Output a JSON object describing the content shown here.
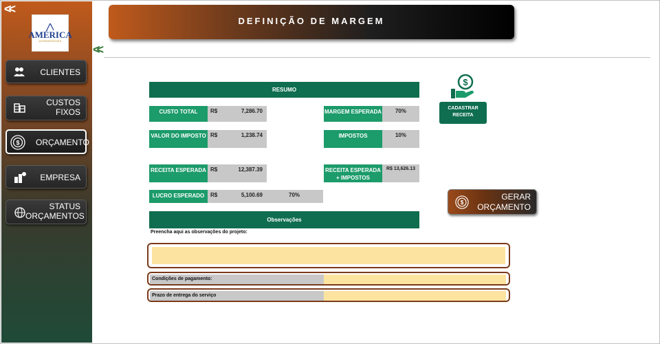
{
  "sidebar": {
    "collapse_icon": "double-chevron-left-icon",
    "logo": {
      "main": "AMÉRICA",
      "sub": "AGRIMENSURA"
    },
    "items": [
      {
        "label": "CLIENTES",
        "icon": "users-icon"
      },
      {
        "label": "CUSTOS FIXOS",
        "icon": "coins-icon"
      },
      {
        "label": "ORÇAMENTO",
        "icon": "target-dollar-icon",
        "active": true
      },
      {
        "label": "EMPRESA",
        "icon": "building-icon"
      },
      {
        "label": "STATUS ORÇAMENTOS",
        "icon": "globe-icon"
      }
    ]
  },
  "header": {
    "title": "DEFINIÇÃO DE MARGEM"
  },
  "resumo": {
    "title": "RESUMO",
    "custo_total": {
      "label": "CUSTO TOTAL",
      "currency": "R$",
      "value": "7,286.70"
    },
    "valor_imposto": {
      "label": "VALOR DO IMPOSTO",
      "currency": "R$",
      "value": "1,238.74"
    },
    "receita_esperada": {
      "label": "RECEITA ESPERADA",
      "currency": "R$",
      "value": "12,387.39"
    },
    "lucro_esperado": {
      "label": "LUCRO ESPERADO",
      "currency": "R$",
      "value": "5,100.69",
      "percent": "70%"
    },
    "margem_esperada": {
      "label": "MARGEM ESPERADA",
      "value": "70%"
    },
    "impostos": {
      "label": "IMPOSTOS",
      "value": "10%"
    },
    "receita_impostos": {
      "label_line1": "RECEITA ESPERADA",
      "label_line2": "+ IMPOSTOS",
      "value": "R$ 13,626.13"
    }
  },
  "actions": {
    "cadastrar_line1": "CADASTRAR",
    "cadastrar_line2": "RECEITA",
    "gerar_line1": "GERAR",
    "gerar_line2": "ORÇAMENTO"
  },
  "observacoes": {
    "title": "Observações",
    "hint": "Preencha aqui as observações do projeto:",
    "condicoes_label": "Condições de pagamento:",
    "prazo_label": "Prazo de entrega do serviço"
  },
  "colors": {
    "accent_green": "#0f6e4f",
    "cell_green": "#1c9b6b",
    "brand_orange": "#c05a1c",
    "field_yellow": "#fde3a0"
  }
}
